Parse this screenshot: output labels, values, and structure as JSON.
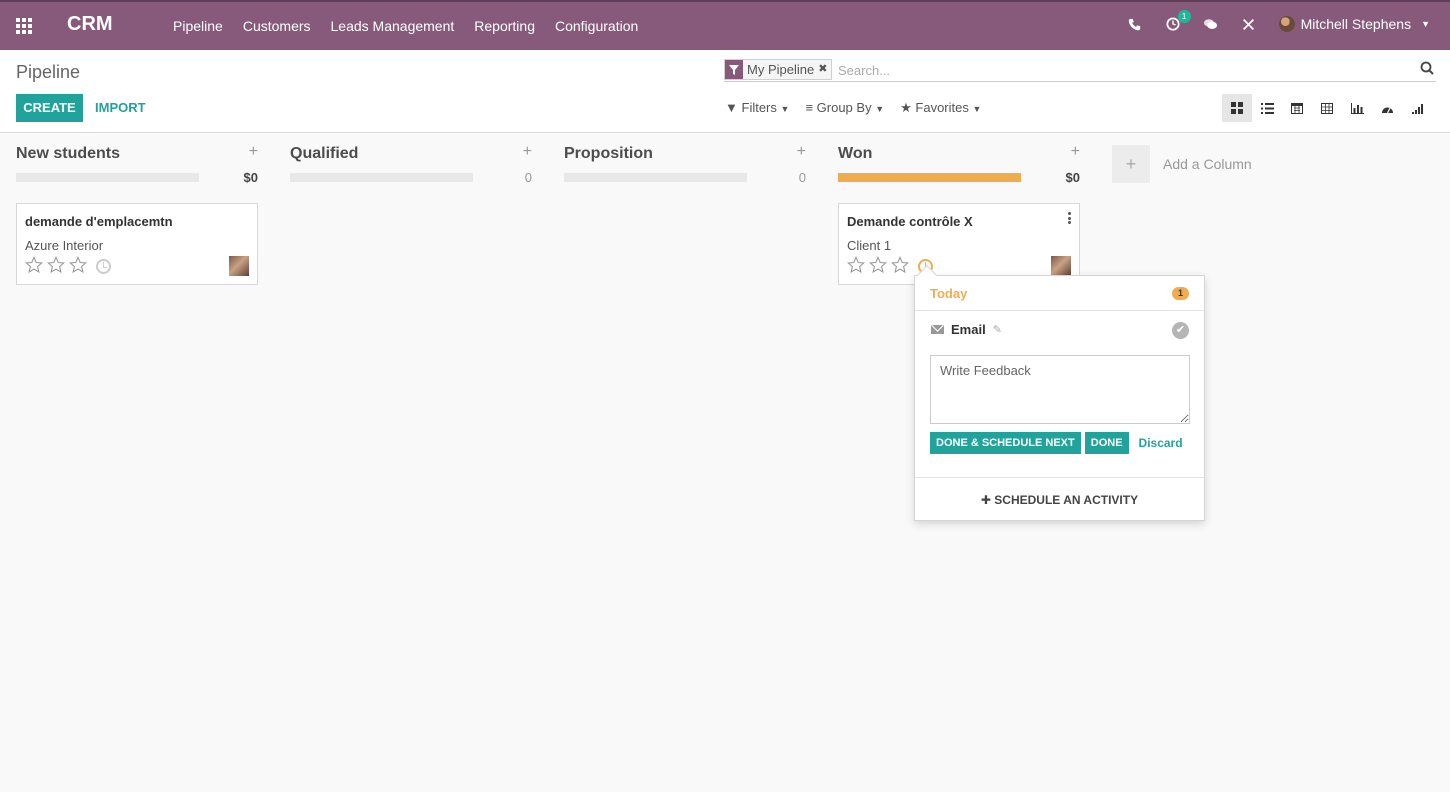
{
  "navbar": {
    "brand": "CRM",
    "menu": [
      "Pipeline",
      "Customers",
      "Leads Management",
      "Reporting",
      "Configuration"
    ],
    "activity_count": "1",
    "user_name": "Mitchell Stephens",
    "color": "#875a7b"
  },
  "control_panel": {
    "breadcrumb": "Pipeline",
    "create_label": "CREATE",
    "import_label": "IMPORT",
    "facet_value": "My Pipeline",
    "search_placeholder": "Search...",
    "filters_label": "Filters",
    "group_by_label": "Group By",
    "favorites_label": "Favorites",
    "views": [
      "kanban",
      "list",
      "calendar",
      "pivot",
      "graph",
      "dashboard",
      "cohort"
    ],
    "active_view": "kanban"
  },
  "columns": [
    {
      "title": "New students",
      "sum": "$0",
      "progress": 0
    },
    {
      "title": "Qualified",
      "sum": "0",
      "progress": 0
    },
    {
      "title": "Proposition",
      "sum": "0",
      "progress": 0
    },
    {
      "title": "Won",
      "sum": "$0",
      "progress": 1
    }
  ],
  "cards": [
    {
      "title": "demande d'emplacemtn",
      "partner": "Azure Interior"
    },
    {
      "title": "Demande contrôle X",
      "partner": "Client 1"
    }
  ],
  "add_column_label": "Add a Column",
  "activity_popover": {
    "header": "Today",
    "count": "1",
    "activity": "Email",
    "feedback_placeholder": "Write Feedback",
    "done_schedule_label": "DONE & SCHEDULE NEXT",
    "done_label": "DONE",
    "discard_label": "Discard",
    "schedule_label": "✚ SCHEDULE AN ACTIVITY"
  },
  "colors": {
    "accent": "#21a39b",
    "warning": "#f0ad4e"
  }
}
